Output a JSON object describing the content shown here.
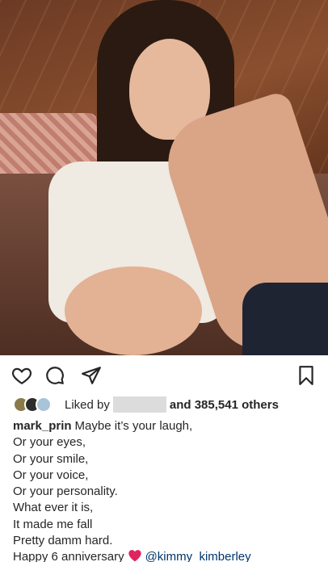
{
  "post": {
    "photo_alt": "Photo of a woman in a white dress seated on a sofa"
  },
  "actions": {
    "like_icon": "heart-icon",
    "comment_icon": "comment-icon",
    "share_icon": "paper-plane-icon",
    "save_icon": "bookmark-icon"
  },
  "likes": {
    "prefix": "Liked by",
    "suffix_count": "and 385,541 others"
  },
  "caption": {
    "username": "mark_prin",
    "first_line": "Maybe it’s your laugh,",
    "lines": [
      "Or your eyes,",
      "Or your smile,",
      "Or your voice,",
      "Or your personality.",
      "What ever it is,",
      "It made me fall",
      "Pretty damm hard."
    ],
    "last_line_text": "Happy 6 anniversary",
    "mention": "@kimmy_kimberley"
  },
  "colors": {
    "text": "#262626",
    "mention": "#003569",
    "heart_emoji": "#e0245e",
    "redaction": "#dcdcdc"
  }
}
